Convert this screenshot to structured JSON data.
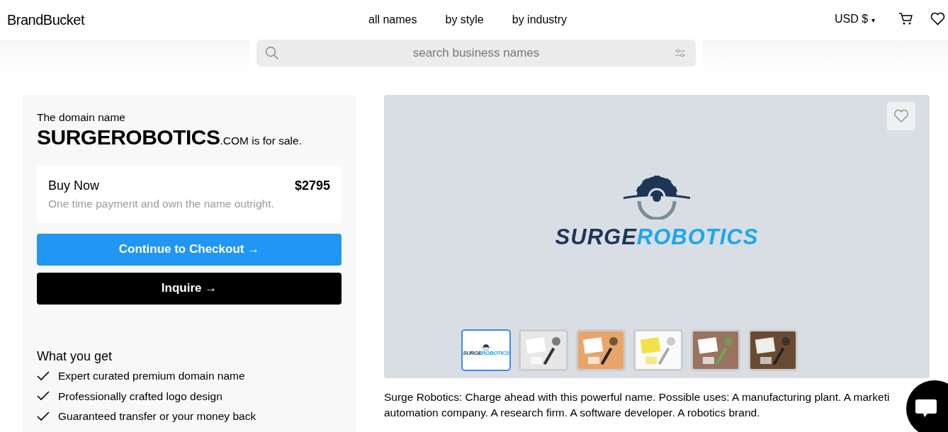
{
  "brand": "BrandBucket",
  "nav": [
    {
      "label": "all names"
    },
    {
      "label": "by style"
    },
    {
      "label": "by industry"
    }
  ],
  "currency": {
    "label": "USD $",
    "caret": "▾"
  },
  "search": {
    "placeholder": "search business names"
  },
  "sale": {
    "intro": "The domain name",
    "name": "SURGEROBOTICS",
    "tld": ".COM",
    "suffix": " is for sale."
  },
  "buy": {
    "title": "Buy Now",
    "subtitle": "One time payment and own the name outright.",
    "price": "$2795"
  },
  "buttons": [
    {
      "kind": "primary",
      "label": "Continue to Checkout",
      "arrow": "→"
    },
    {
      "kind": "dark",
      "label": "Inquire",
      "arrow": "→"
    }
  ],
  "benefits": {
    "title": "What you get",
    "items": [
      "Expert curated premium domain name",
      "Professionally crafted logo design",
      "Guaranteed transfer or your money back"
    ]
  },
  "logo": {
    "part_1": "SURGE",
    "part_2": "ROBOTICS"
  },
  "thumbnails": [
    {
      "kind": "logo",
      "selected": true,
      "part_1": "SURGE",
      "part_2": "ROBOTICS"
    },
    {
      "kind": "picture",
      "selected": false
    },
    {
      "kind": "picture",
      "selected": false
    },
    {
      "kind": "picture",
      "selected": false
    },
    {
      "kind": "picture",
      "selected": false
    },
    {
      "kind": "picture",
      "selected": false
    }
  ],
  "description_lines": [
    "Surge Robotics: Charge ahead with this powerful name. Possible uses: A manufacturing plant. A marketi",
    "automation company. A research firm. A software developer. A robotics brand."
  ]
}
